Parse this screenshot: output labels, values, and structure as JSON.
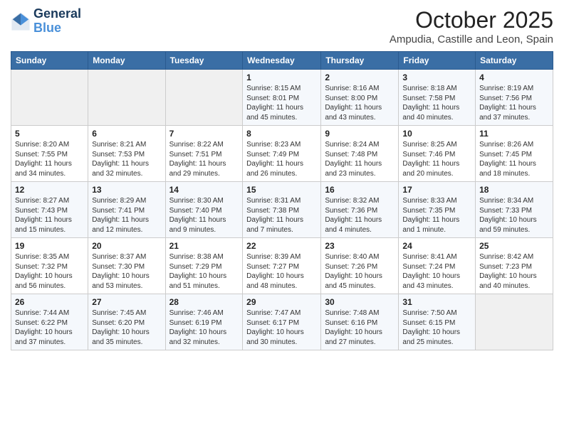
{
  "header": {
    "logo_line1": "General",
    "logo_line2": "Blue",
    "month": "October 2025",
    "location": "Ampudia, Castille and Leon, Spain"
  },
  "days_of_week": [
    "Sunday",
    "Monday",
    "Tuesday",
    "Wednesday",
    "Thursday",
    "Friday",
    "Saturday"
  ],
  "weeks": [
    [
      {
        "day": "",
        "info": ""
      },
      {
        "day": "",
        "info": ""
      },
      {
        "day": "",
        "info": ""
      },
      {
        "day": "1",
        "info": "Sunrise: 8:15 AM\nSunset: 8:01 PM\nDaylight: 11 hours\nand 45 minutes."
      },
      {
        "day": "2",
        "info": "Sunrise: 8:16 AM\nSunset: 8:00 PM\nDaylight: 11 hours\nand 43 minutes."
      },
      {
        "day": "3",
        "info": "Sunrise: 8:18 AM\nSunset: 7:58 PM\nDaylight: 11 hours\nand 40 minutes."
      },
      {
        "day": "4",
        "info": "Sunrise: 8:19 AM\nSunset: 7:56 PM\nDaylight: 11 hours\nand 37 minutes."
      }
    ],
    [
      {
        "day": "5",
        "info": "Sunrise: 8:20 AM\nSunset: 7:55 PM\nDaylight: 11 hours\nand 34 minutes."
      },
      {
        "day": "6",
        "info": "Sunrise: 8:21 AM\nSunset: 7:53 PM\nDaylight: 11 hours\nand 32 minutes."
      },
      {
        "day": "7",
        "info": "Sunrise: 8:22 AM\nSunset: 7:51 PM\nDaylight: 11 hours\nand 29 minutes."
      },
      {
        "day": "8",
        "info": "Sunrise: 8:23 AM\nSunset: 7:49 PM\nDaylight: 11 hours\nand 26 minutes."
      },
      {
        "day": "9",
        "info": "Sunrise: 8:24 AM\nSunset: 7:48 PM\nDaylight: 11 hours\nand 23 minutes."
      },
      {
        "day": "10",
        "info": "Sunrise: 8:25 AM\nSunset: 7:46 PM\nDaylight: 11 hours\nand 20 minutes."
      },
      {
        "day": "11",
        "info": "Sunrise: 8:26 AM\nSunset: 7:45 PM\nDaylight: 11 hours\nand 18 minutes."
      }
    ],
    [
      {
        "day": "12",
        "info": "Sunrise: 8:27 AM\nSunset: 7:43 PM\nDaylight: 11 hours\nand 15 minutes."
      },
      {
        "day": "13",
        "info": "Sunrise: 8:29 AM\nSunset: 7:41 PM\nDaylight: 11 hours\nand 12 minutes."
      },
      {
        "day": "14",
        "info": "Sunrise: 8:30 AM\nSunset: 7:40 PM\nDaylight: 11 hours\nand 9 minutes."
      },
      {
        "day": "15",
        "info": "Sunrise: 8:31 AM\nSunset: 7:38 PM\nDaylight: 11 hours\nand 7 minutes."
      },
      {
        "day": "16",
        "info": "Sunrise: 8:32 AM\nSunset: 7:36 PM\nDaylight: 11 hours\nand 4 minutes."
      },
      {
        "day": "17",
        "info": "Sunrise: 8:33 AM\nSunset: 7:35 PM\nDaylight: 11 hours\nand 1 minute."
      },
      {
        "day": "18",
        "info": "Sunrise: 8:34 AM\nSunset: 7:33 PM\nDaylight: 10 hours\nand 59 minutes."
      }
    ],
    [
      {
        "day": "19",
        "info": "Sunrise: 8:35 AM\nSunset: 7:32 PM\nDaylight: 10 hours\nand 56 minutes."
      },
      {
        "day": "20",
        "info": "Sunrise: 8:37 AM\nSunset: 7:30 PM\nDaylight: 10 hours\nand 53 minutes."
      },
      {
        "day": "21",
        "info": "Sunrise: 8:38 AM\nSunset: 7:29 PM\nDaylight: 10 hours\nand 51 minutes."
      },
      {
        "day": "22",
        "info": "Sunrise: 8:39 AM\nSunset: 7:27 PM\nDaylight: 10 hours\nand 48 minutes."
      },
      {
        "day": "23",
        "info": "Sunrise: 8:40 AM\nSunset: 7:26 PM\nDaylight: 10 hours\nand 45 minutes."
      },
      {
        "day": "24",
        "info": "Sunrise: 8:41 AM\nSunset: 7:24 PM\nDaylight: 10 hours\nand 43 minutes."
      },
      {
        "day": "25",
        "info": "Sunrise: 8:42 AM\nSunset: 7:23 PM\nDaylight: 10 hours\nand 40 minutes."
      }
    ],
    [
      {
        "day": "26",
        "info": "Sunrise: 7:44 AM\nSunset: 6:22 PM\nDaylight: 10 hours\nand 37 minutes."
      },
      {
        "day": "27",
        "info": "Sunrise: 7:45 AM\nSunset: 6:20 PM\nDaylight: 10 hours\nand 35 minutes."
      },
      {
        "day": "28",
        "info": "Sunrise: 7:46 AM\nSunset: 6:19 PM\nDaylight: 10 hours\nand 32 minutes."
      },
      {
        "day": "29",
        "info": "Sunrise: 7:47 AM\nSunset: 6:17 PM\nDaylight: 10 hours\nand 30 minutes."
      },
      {
        "day": "30",
        "info": "Sunrise: 7:48 AM\nSunset: 6:16 PM\nDaylight: 10 hours\nand 27 minutes."
      },
      {
        "day": "31",
        "info": "Sunrise: 7:50 AM\nSunset: 6:15 PM\nDaylight: 10 hours\nand 25 minutes."
      },
      {
        "day": "",
        "info": ""
      }
    ]
  ]
}
